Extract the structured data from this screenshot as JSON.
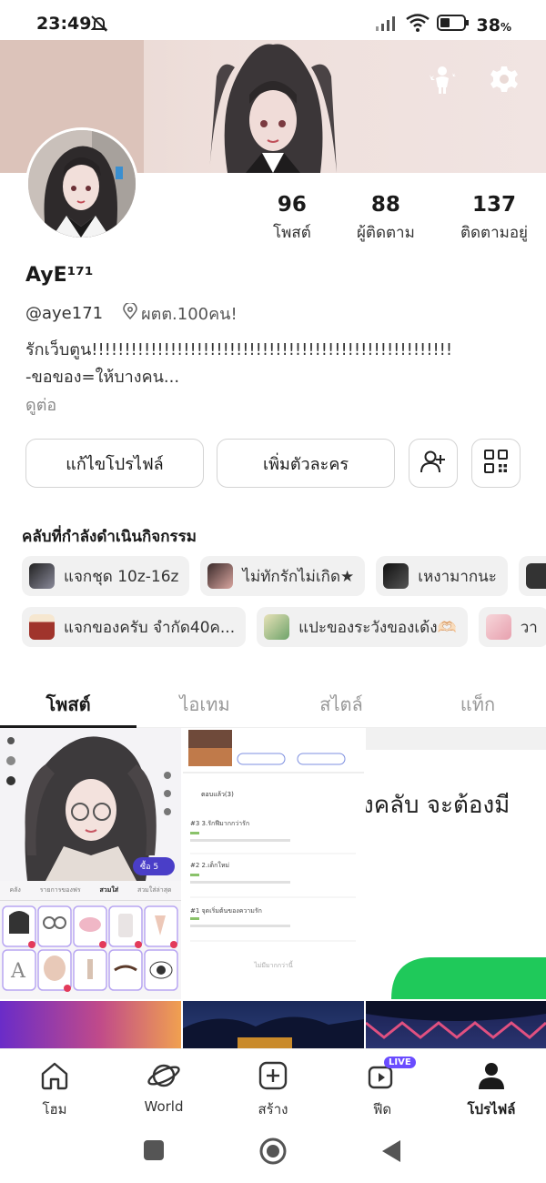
{
  "status": {
    "time": "23:49",
    "battery": "38",
    "battery_unit": "%"
  },
  "profile": {
    "display_name": "AyE¹⁷¹",
    "handle": "@aye171",
    "location": "ผตต.100คน!",
    "bio_line1": "รักเว็บตูน!!!!!!!!!!!!!!!!!!!!!!!!!!!!!!!!!!!!!!!!!!!!!!!!!!!!!!!",
    "bio_line2": "-ขอของ=ให้บางคน...",
    "more": "ดูต่อ"
  },
  "stats": [
    {
      "value": "96",
      "label": "โพสต์"
    },
    {
      "value": "88",
      "label": "ผู้ติดตาม"
    },
    {
      "value": "137",
      "label": "ติดตามอยู่"
    }
  ],
  "buttons": {
    "edit_profile": "แก้ไขโปรไฟล์",
    "add_character": "เพิ่มตัวละคร"
  },
  "clubs": {
    "title": "คลับที่กำลังดำเนินกิจกรรม",
    "row1": [
      "แจกชุด 10z-16z",
      "ไม่ทักรักไม่เกิด★",
      "เหงามากนะ"
    ],
    "row2": [
      "แจกของครับ จำกัด40ค...",
      "แปะของระวังของเด้ง🫶🏻",
      "วา"
    ]
  },
  "tabs": [
    "โพสต์",
    "ไอเทม",
    "สไตล์",
    "แท็ก"
  ],
  "grid": {
    "shop_tab1": "คลัง",
    "shop_tab2": "รายการของฟร",
    "shop_tab3": "สวมใส่",
    "shop_tab4": "สวมใส่ล่าสุด",
    "buy_label": "ซื้อ 5",
    "feed_comments": "ตอบแล้ว(3)",
    "feed_item1": "#3 3.รักฟีมากกว่ารัก",
    "feed_item2": "#2 2.เด็กใหม่",
    "feed_item3": "#1 จุดเริ่มต้นของความรัก",
    "feed_no_more": "ไม่มีมากกว่านี้",
    "banner_text": "งคลับ จะต้องมี"
  },
  "nav": [
    {
      "label": "โฮม",
      "icon": "home-icon"
    },
    {
      "label": "World",
      "icon": "planet-icon"
    },
    {
      "label": "สร้าง",
      "icon": "create-icon"
    },
    {
      "label": "ฟีด",
      "icon": "feed-icon",
      "badge": "LIVE"
    },
    {
      "label": "โปรไฟล์",
      "icon": "profile-icon"
    }
  ],
  "colors": {
    "live_badge": "#6a4cff",
    "accent_green": "#1fc95a"
  }
}
